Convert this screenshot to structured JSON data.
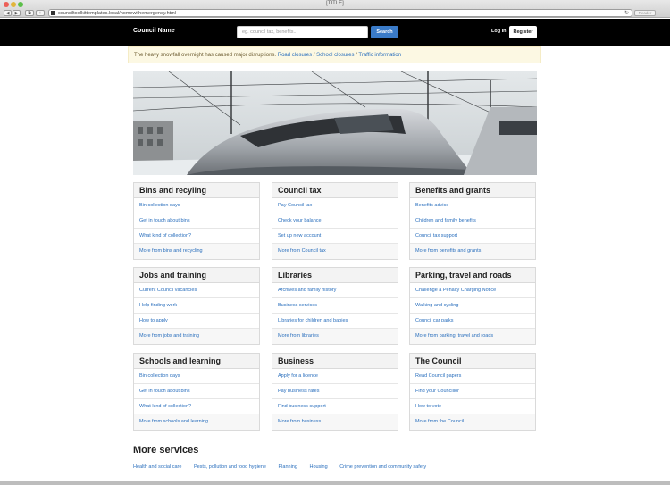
{
  "browser": {
    "window_title": "[TITLE]",
    "url": "counciltoolkittemplates.local/homewithemergency.html",
    "reader_label": "Reader"
  },
  "header": {
    "brand": "Council Name",
    "search_placeholder": "eg. council tax, benefits...",
    "search_button": "Search",
    "login": "Log In",
    "register": "Register"
  },
  "alert": {
    "text": "The heavy snowfall overnight has caused major disruptions.",
    "links": [
      "Road closures",
      "School closures",
      "Traffic information"
    ],
    "separator": "/"
  },
  "cards": [
    {
      "title": "Bins and recyling",
      "links": [
        "Bin collection days",
        "Get in touch about bins",
        "What kind of collection?"
      ],
      "more": "More from bins and recycling"
    },
    {
      "title": "Council tax",
      "links": [
        "Pay Council tax",
        "Check your balance",
        "Set up new account"
      ],
      "more": "More from Council tax"
    },
    {
      "title": "Benefits and grants",
      "links": [
        "Benefits advice",
        "Children and family benefits",
        "Council tax support"
      ],
      "more": "More from benefits and grants"
    },
    {
      "title": "Jobs and training",
      "links": [
        "Current Council vacancies",
        "Help finding work",
        "How to apply"
      ],
      "more": "More from jobs and training"
    },
    {
      "title": "Libraries",
      "links": [
        "Archives and family history",
        "Business services",
        "Libraries for children and babies"
      ],
      "more": "More from libraries"
    },
    {
      "title": "Parking, travel and roads",
      "links": [
        "Challenge a Penalty Charging Notice",
        "Walking and cycling",
        "Council car parks"
      ],
      "more": "More from parking, travel and roads"
    },
    {
      "title": "Schools and learning",
      "links": [
        "Bin collection days",
        "Get in touch about bins",
        "What kind of collection?"
      ],
      "more": "More from schools and learning"
    },
    {
      "title": "Business",
      "links": [
        "Apply for a licence",
        "Pay business rates",
        "Find business support"
      ],
      "more": "More from business"
    },
    {
      "title": "The Council",
      "links": [
        "Read Council papers",
        "Find your Councillor",
        "How to vote"
      ],
      "more": "More from the Council"
    }
  ],
  "more_services": {
    "title": "More services",
    "links": [
      "Health and social care",
      "Pests, pollution and food hygiene",
      "Planning",
      "Housing",
      "Crime prevention and community safety"
    ]
  }
}
